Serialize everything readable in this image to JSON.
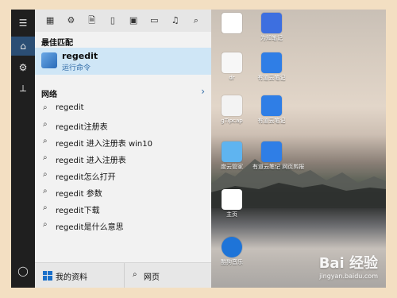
{
  "start_menu": {
    "best_match_label": "最佳匹配",
    "best_match": {
      "name": "regedit",
      "subtitle": "运行命令",
      "icon": "regedit-icon"
    },
    "web_section_label": "网络",
    "web_results": [
      "regedit",
      "regedit注册表",
      "regedit 进入注册表 win10",
      "regedit 进入注册表",
      "regedit怎么打开",
      "regedit 参数",
      "regedit下载",
      "regedit是什么意思"
    ],
    "bottom_left_label": "我的资料",
    "bottom_right_label": "网页"
  },
  "desktop": {
    "icons": [
      {
        "label": "",
        "icon": "file-icon"
      },
      {
        "label": "为知笔记",
        "icon": "app-icon"
      },
      {
        "label": "dr",
        "icon": "file-icon"
      },
      {
        "label": "有道云笔记",
        "icon": "app-icon"
      },
      {
        "label": "gTipcap",
        "icon": "app-icon"
      },
      {
        "label": "有道云笔记",
        "icon": "app-icon"
      },
      {
        "label": "度云管家",
        "icon": "cloud-icon"
      },
      {
        "label": "有道云笔记 网页剪报",
        "icon": "clip-icon"
      },
      {
        "label": "主页",
        "icon": "home-icon"
      },
      {
        "label": "酷狗音乐",
        "icon": "k-icon"
      }
    ],
    "watermark": {
      "brand": "Bai 经验",
      "url": "jingyan.baidu.com"
    }
  }
}
